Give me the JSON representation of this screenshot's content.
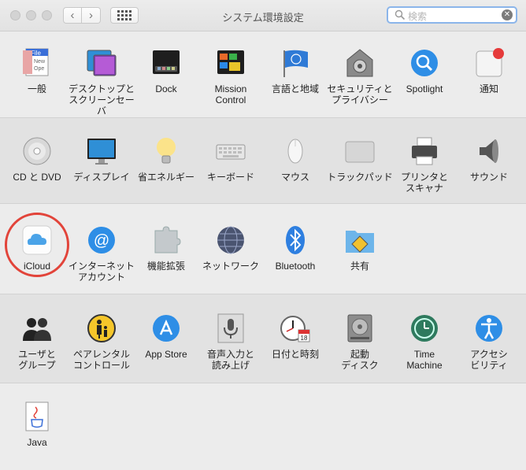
{
  "window": {
    "title": "システム環境設定",
    "search_placeholder": "検索"
  },
  "colors": {
    "highlight_ring": "#e2443a",
    "search_focus": "#8bb5ea"
  },
  "rows": [
    {
      "items": [
        {
          "label": "一般",
          "icon": "general-icon"
        },
        {
          "label": "デスクトップと\nスクリーンセーバ",
          "icon": "desktop-screensaver-icon"
        },
        {
          "label": "Dock",
          "icon": "dock-icon"
        },
        {
          "label": "Mission\nControl",
          "icon": "mission-control-icon"
        },
        {
          "label": "言語と地域",
          "icon": "language-region-icon"
        },
        {
          "label": "セキュリティと\nプライバシー",
          "icon": "security-privacy-icon"
        },
        {
          "label": "Spotlight",
          "icon": "spotlight-icon"
        },
        {
          "label": "通知",
          "icon": "notifications-icon"
        }
      ]
    },
    {
      "items": [
        {
          "label": "CD と DVD",
          "icon": "cd-dvd-icon"
        },
        {
          "label": "ディスプレイ",
          "icon": "display-icon"
        },
        {
          "label": "省エネルギー",
          "icon": "energy-saver-icon"
        },
        {
          "label": "キーボード",
          "icon": "keyboard-icon"
        },
        {
          "label": "マウス",
          "icon": "mouse-icon"
        },
        {
          "label": "トラックパッド",
          "icon": "trackpad-icon"
        },
        {
          "label": "プリンタと\nスキャナ",
          "icon": "printer-scanner-icon"
        },
        {
          "label": "サウンド",
          "icon": "sound-icon"
        }
      ]
    },
    {
      "items": [
        {
          "label": "iCloud",
          "icon": "icloud-icon"
        },
        {
          "label": "インターネット\nアカウント",
          "icon": "internet-accounts-icon"
        },
        {
          "label": "機能拡張",
          "icon": "extensions-icon"
        },
        {
          "label": "ネットワーク",
          "icon": "network-icon"
        },
        {
          "label": "Bluetooth",
          "icon": "bluetooth-icon"
        },
        {
          "label": "共有",
          "icon": "sharing-icon"
        }
      ]
    },
    {
      "items": [
        {
          "label": "ユーザと\nグループ",
          "icon": "users-groups-icon"
        },
        {
          "label": "ペアレンタル\nコントロール",
          "icon": "parental-controls-icon"
        },
        {
          "label": "App Store",
          "icon": "app-store-icon"
        },
        {
          "label": "音声入力と\n読み上げ",
          "icon": "dictation-speech-icon"
        },
        {
          "label": "日付と時刻",
          "icon": "date-time-icon"
        },
        {
          "label": "起動\nディスク",
          "icon": "startup-disk-icon"
        },
        {
          "label": "Time\nMachine",
          "icon": "time-machine-icon"
        },
        {
          "label": "アクセシ\nビリティ",
          "icon": "accessibility-icon"
        }
      ]
    },
    {
      "items": [
        {
          "label": "Java",
          "icon": "java-icon"
        }
      ]
    }
  ]
}
